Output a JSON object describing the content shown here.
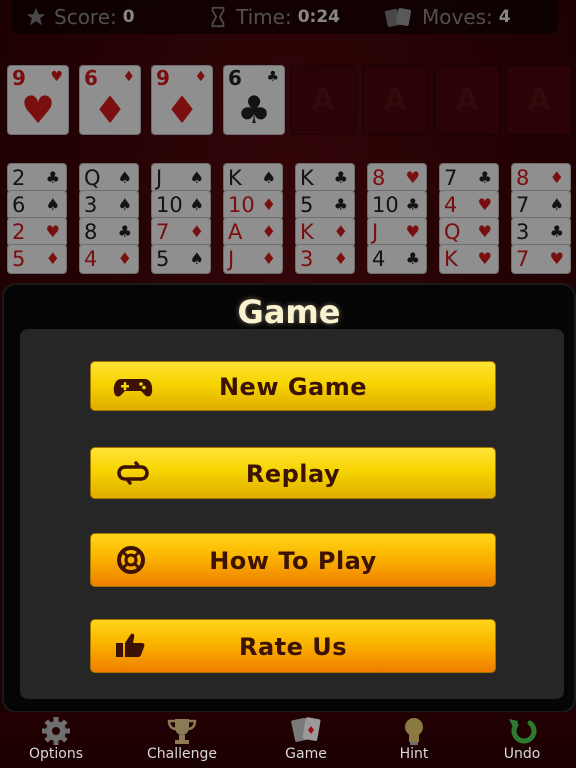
{
  "status": {
    "score_label": "Score:",
    "score_value": "0",
    "time_label": "Time:",
    "time_value": "0:24",
    "moves_label": "Moves:",
    "moves_value": "4"
  },
  "free_cells": [
    {
      "rank": "9",
      "suit": "♥",
      "color": "red"
    },
    {
      "rank": "6",
      "suit": "♦",
      "color": "red"
    },
    {
      "rank": "9",
      "suit": "♦",
      "color": "red"
    },
    {
      "rank": "6",
      "suit": "♣",
      "color": "black"
    }
  ],
  "foundations": [
    "A",
    "A",
    "A",
    "A"
  ],
  "tableau": [
    [
      {
        "rank": "2",
        "suit": "♣",
        "color": "black"
      },
      {
        "rank": "6",
        "suit": "♠",
        "color": "black"
      },
      {
        "rank": "2",
        "suit": "♥",
        "color": "red"
      },
      {
        "rank": "5",
        "suit": "♦",
        "color": "red"
      }
    ],
    [
      {
        "rank": "Q",
        "suit": "♠",
        "color": "black"
      },
      {
        "rank": "3",
        "suit": "♠",
        "color": "black"
      },
      {
        "rank": "8",
        "suit": "♣",
        "color": "black"
      },
      {
        "rank": "4",
        "suit": "♦",
        "color": "red"
      }
    ],
    [
      {
        "rank": "J",
        "suit": "♠",
        "color": "black"
      },
      {
        "rank": "10",
        "suit": "♠",
        "color": "black"
      },
      {
        "rank": "7",
        "suit": "♦",
        "color": "red"
      },
      {
        "rank": "5",
        "suit": "♠",
        "color": "black"
      }
    ],
    [
      {
        "rank": "K",
        "suit": "♠",
        "color": "black"
      },
      {
        "rank": "10",
        "suit": "♦",
        "color": "red"
      },
      {
        "rank": "A",
        "suit": "♦",
        "color": "red"
      },
      {
        "rank": "J",
        "suit": "♦",
        "color": "red"
      }
    ],
    [
      {
        "rank": "K",
        "suit": "♣",
        "color": "black"
      },
      {
        "rank": "5",
        "suit": "♣",
        "color": "black"
      },
      {
        "rank": "K",
        "suit": "♦",
        "color": "red"
      },
      {
        "rank": "3",
        "suit": "♦",
        "color": "red"
      }
    ],
    [
      {
        "rank": "8",
        "suit": "♥",
        "color": "red"
      },
      {
        "rank": "10",
        "suit": "♣",
        "color": "black"
      },
      {
        "rank": "J",
        "suit": "♥",
        "color": "red"
      },
      {
        "rank": "4",
        "suit": "♣",
        "color": "black"
      }
    ],
    [
      {
        "rank": "7",
        "suit": "♣",
        "color": "black"
      },
      {
        "rank": "4",
        "suit": "♥",
        "color": "red"
      },
      {
        "rank": "Q",
        "suit": "♥",
        "color": "red"
      },
      {
        "rank": "K",
        "suit": "♥",
        "color": "red"
      }
    ],
    [
      {
        "rank": "8",
        "suit": "♦",
        "color": "red"
      },
      {
        "rank": "7",
        "suit": "♠",
        "color": "black"
      },
      {
        "rank": "3",
        "suit": "♣",
        "color": "black"
      },
      {
        "rank": "7",
        "suit": "♥",
        "color": "red"
      }
    ]
  ],
  "dialog": {
    "title": "Game",
    "buttons": [
      {
        "label": "New Game",
        "icon": "gamepad-icon"
      },
      {
        "label": "Replay",
        "icon": "replay-icon"
      },
      {
        "label": "How To Play",
        "icon": "lifebuoy-icon"
      },
      {
        "label": "Rate Us",
        "icon": "thumbs-up-icon"
      }
    ]
  },
  "toolbar": {
    "options": "Options",
    "challenge": "Challenge",
    "game": "Game",
    "hint": "Hint",
    "undo": "Undo"
  },
  "colors": {
    "red_suit": "#d11a1a",
    "black_suit": "#222222",
    "felt": "#3b0407",
    "button_yellow": "#f6d400",
    "button_orange": "#f07e00",
    "label_brown": "#3b1203"
  }
}
